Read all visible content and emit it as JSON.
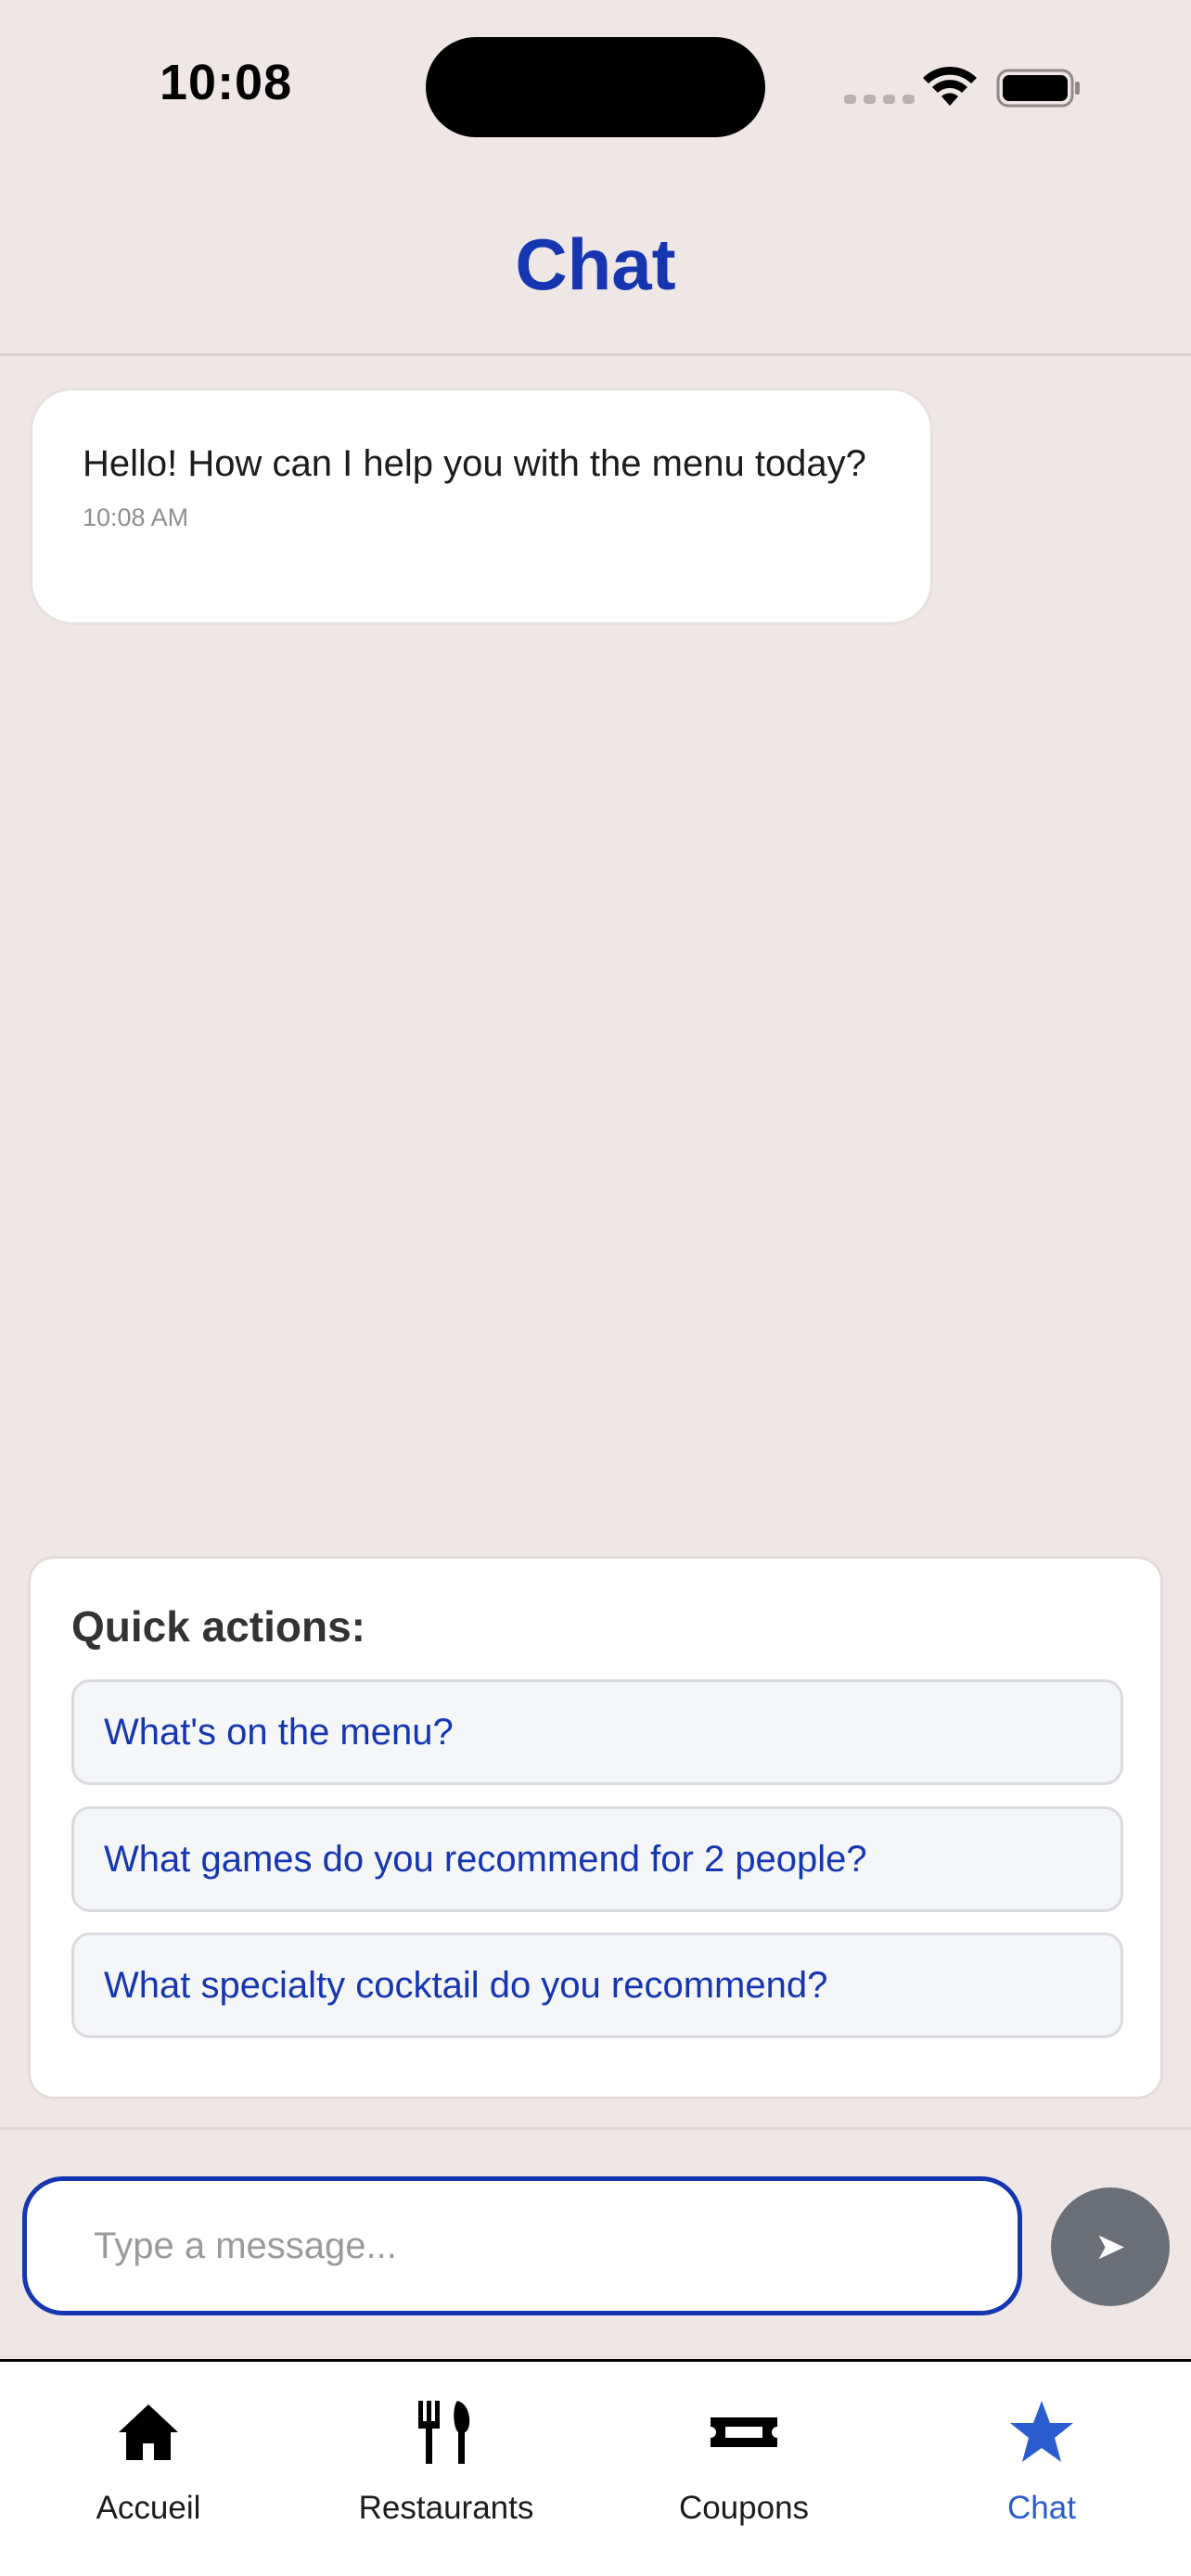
{
  "status_bar": {
    "time": "10:08"
  },
  "header": {
    "title": "Chat"
  },
  "messages": [
    {
      "text": "Hello! How can I help you with the menu today?",
      "time": "10:08 AM"
    }
  ],
  "quick_actions": {
    "title": "Quick actions:",
    "items": [
      "What's on the menu?",
      "What games do you recommend for 2 people?",
      "What specialty cocktail do you recommend?"
    ]
  },
  "composer": {
    "placeholder": "Type a message...",
    "send_icon": "➤"
  },
  "tabs": [
    {
      "label": "Accueil",
      "icon": "home-icon"
    },
    {
      "label": "Restaurants",
      "icon": "fork-knife-icon"
    },
    {
      "label": "Coupons",
      "icon": "ticket-icon"
    },
    {
      "label": "Chat",
      "icon": "star-icon",
      "active": true
    }
  ],
  "colors": {
    "accent": "#1536b0",
    "tab_active": "#2a5ccf",
    "background": "#efe7e5",
    "send_button": "#6b7078"
  }
}
